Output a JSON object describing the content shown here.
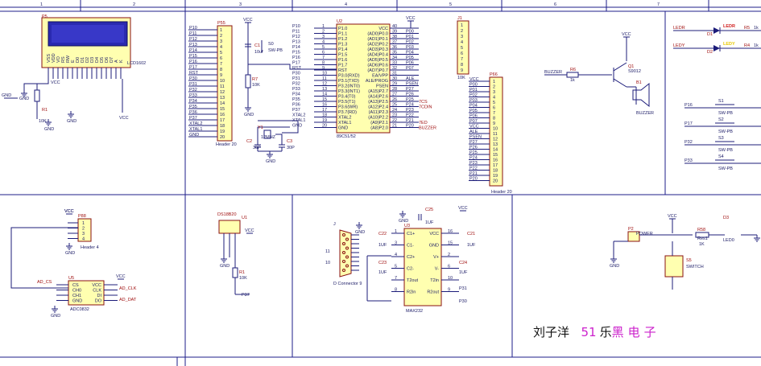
{
  "sheet": {
    "columns": [
      "1",
      "2",
      "3",
      "4",
      "5",
      "6",
      "7"
    ],
    "author": "刘子洋",
    "brand_prefix": "5",
    "brand": "乐",
    "brand_tail": "黑电子",
    "brand_suffix": "1",
    "brand_color": "#cc22cc",
    "frame_color": "#1d1d8a",
    "part_fill": "#ffffb0"
  },
  "lcd": {
    "ref": "P5",
    "name": "LCD1602",
    "pins": [
      "VSS",
      "VDD",
      "VO",
      "RS",
      "RW",
      "E",
      "D0",
      "D1",
      "D2",
      "D3",
      "D4",
      "D5",
      "D6",
      "D7",
      "A",
      "K"
    ],
    "r_ref": "R1",
    "r_val": "10K",
    "gnd": "GND",
    "vcc": "VCC"
  },
  "p55": {
    "ref": "P55",
    "name": "Header 20",
    "nets": [
      "P10",
      "P11",
      "P12",
      "P13",
      "P14",
      "P15",
      "P16",
      "P17",
      "RST",
      "P30",
      "P31",
      "P32",
      "P33",
      "P34",
      "P35",
      "P36",
      "P37",
      "XTAL2",
      "XTAL1",
      "GND"
    ]
  },
  "reset": {
    "vcc": "VCC",
    "c1": "C1",
    "c1_val": "10uf",
    "s0": "S0",
    "s0_val": "SW-PB",
    "r7": "R7",
    "r7_val": "10K",
    "gnd": "GND"
  },
  "mcu": {
    "ref": "U2",
    "name": "89C51/52",
    "vcc": "VCC",
    "left_nets": [
      "P10",
      "P11",
      "P12",
      "P13",
      "P14",
      "P15",
      "P16",
      "P17",
      "RST",
      "P30",
      "P31",
      "P32",
      "P33",
      "P34",
      "P35",
      "P36",
      "P37",
      "XTAL2",
      "XTAL1",
      "GND"
    ],
    "left_pins": [
      "1",
      "2",
      "3",
      "4",
      "5",
      "6",
      "7",
      "8",
      "9",
      "10",
      "11",
      "12",
      "13",
      "14",
      "15",
      "16",
      "17",
      "18",
      "19",
      "20"
    ],
    "left_labels": [
      "P1.0",
      "P1.1",
      "P1.2",
      "P1.3",
      "P1.4",
      "P1.5",
      "P1.6",
      "P1.7",
      "RST",
      "P3.0(RXD)",
      "P3.1(TXD)",
      "P3.2(INT0)",
      "P3.3(INT1)",
      "P3.4(T0)",
      "P3.5(T1)",
      "P3.6(WR)",
      "P3.7(RD)",
      "XTAL2",
      "XTAL1",
      "GND"
    ],
    "right_labels": [
      "VCC",
      "(AD0)P0.0",
      "(AD1)P0.1",
      "(AD2)P0.2",
      "(AD3)P0.3",
      "(AD4)P0.4",
      "(AD5)P0.5",
      "(AD6)P0.6",
      "(AD7)P0.7",
      "EA/VPP",
      "ALE/PROG",
      "PSEN",
      "(A15)P2.7",
      "(A14)P2.6",
      "(A13)P2.5",
      "(A12)P2.4",
      "(A11)P2.3",
      "(A10)P2.2",
      "(A9)P2.1",
      "(A8)P2.0"
    ],
    "right_pins": [
      "40",
      "39",
      "38",
      "37",
      "36",
      "35",
      "34",
      "33",
      "32",
      "31",
      "30",
      "29",
      "28",
      "27",
      "26",
      "25",
      "24",
      "23",
      "22",
      "21"
    ],
    "right_nets": [
      "",
      "P00",
      "P01",
      "P02",
      "P03",
      "P04",
      "P05",
      "P06",
      "P07",
      "",
      "ALE",
      "PSEN",
      "P27",
      "P26",
      "P25",
      "P24",
      "P23",
      "P22",
      "P21",
      "P20"
    ],
    "right_extra": [
      "",
      "",
      "",
      "",
      "",
      "",
      "",
      "",
      "",
      "",
      "",
      "",
      "",
      "",
      "7CS",
      "7CDIN",
      "",
      "",
      "7ED",
      "BUZZER"
    ]
  },
  "crystal": {
    "ref": "Y1",
    "val": "12MHZ",
    "c2": "C2",
    "c3": "C3",
    "cval": "30P",
    "gnd": "GND"
  },
  "j1": {
    "ref": "J1",
    "name": "10K",
    "pins": [
      "1",
      "2",
      "3",
      "4",
      "5",
      "6",
      "7",
      "8",
      "9"
    ]
  },
  "p66": {
    "ref": "P66",
    "name": "Header 20",
    "nets": [
      "VCC",
      "P00",
      "P01",
      "P02",
      "P03",
      "P04",
      "P05",
      "P06",
      "P07",
      "VCC",
      "ALE",
      "PSEN",
      "P27",
      "P26",
      "P25",
      "P24",
      "P23",
      "P22",
      "P21",
      "P20"
    ]
  },
  "buzzer": {
    "net": "BUZZER",
    "r6": "R6",
    "r6_val": "1k",
    "q1": "Q1",
    "q1_val": "S9012",
    "b1": "B1",
    "b1_val": "BUZZER",
    "vcc": "VCC",
    "gnd": "GND"
  },
  "leds": {
    "items": [
      {
        "net": "LEDR",
        "d": "D1",
        "r": "R5",
        "rv": "1k",
        "color": "LEDR"
      },
      {
        "net": "LEDY",
        "d": "D2",
        "r": "R4",
        "rv": "1k",
        "color": "LEDY"
      }
    ]
  },
  "keys": {
    "items": [
      {
        "net": "P16",
        "s": "S1",
        "v": "SW-PB"
      },
      {
        "net": "P17",
        "s": "S2",
        "v": "SW-PB"
      },
      {
        "net": "P32",
        "s": "S3",
        "v": "SW-PB"
      },
      {
        "net": "P33",
        "s": "S4",
        "v": "SW-PB"
      }
    ]
  },
  "adc": {
    "ref": "U5",
    "name": "ADC0832",
    "header": "P88",
    "header_name": "Header 4",
    "left": [
      "CS",
      "CH0",
      "CH1",
      "GND"
    ],
    "right": [
      "VCC",
      "CLK",
      "DI",
      "DO"
    ],
    "nets_l": [
      "AD_CS"
    ],
    "nets_r": [
      "AD_CLK",
      "AD_DAT"
    ],
    "vcc": "VCC",
    "gnd": "GND"
  },
  "ds18b20": {
    "ref": "DS18B20",
    "u": "U1",
    "r": "R1",
    "rv": "10K",
    "net": "P37",
    "vcc": "VCC",
    "gnd": "GND"
  },
  "dconn": {
    "ref": "J",
    "name": "D Connector 9",
    "pins": [
      "11",
      "10"
    ],
    "gnd": "GND"
  },
  "max232": {
    "ref": "U3",
    "name": "MAX232",
    "c25": "C25",
    "c22": "C22",
    "c23": "C23",
    "c21": "C21",
    "c24": "C24",
    "cval": "1UF",
    "left_labels": [
      "C1+",
      "C1-",
      "C2+",
      "C2-",
      "T2out",
      "R2in"
    ],
    "right_labels": [
      "VCC",
      "GND",
      "V+",
      "V-",
      "T2in",
      "R2out"
    ],
    "left_pins": [
      "1",
      "3",
      "4",
      "5",
      "7",
      "8"
    ],
    "right_pins": [
      "16",
      "15",
      "2",
      "6",
      "10",
      "9"
    ],
    "nets": [
      "P31",
      "P30"
    ],
    "vcc": "VCC",
    "gnd": "GND"
  },
  "power": {
    "p2": "P2",
    "p2_val": "POWER",
    "r58": "R58",
    "r58_val": "Res1",
    "r58_k": "1K",
    "d3": "D3",
    "d3_val": "LED0",
    "s5": "S5",
    "s5_val": "SWITCH",
    "vcc": "VCC",
    "gnd": "GND"
  }
}
